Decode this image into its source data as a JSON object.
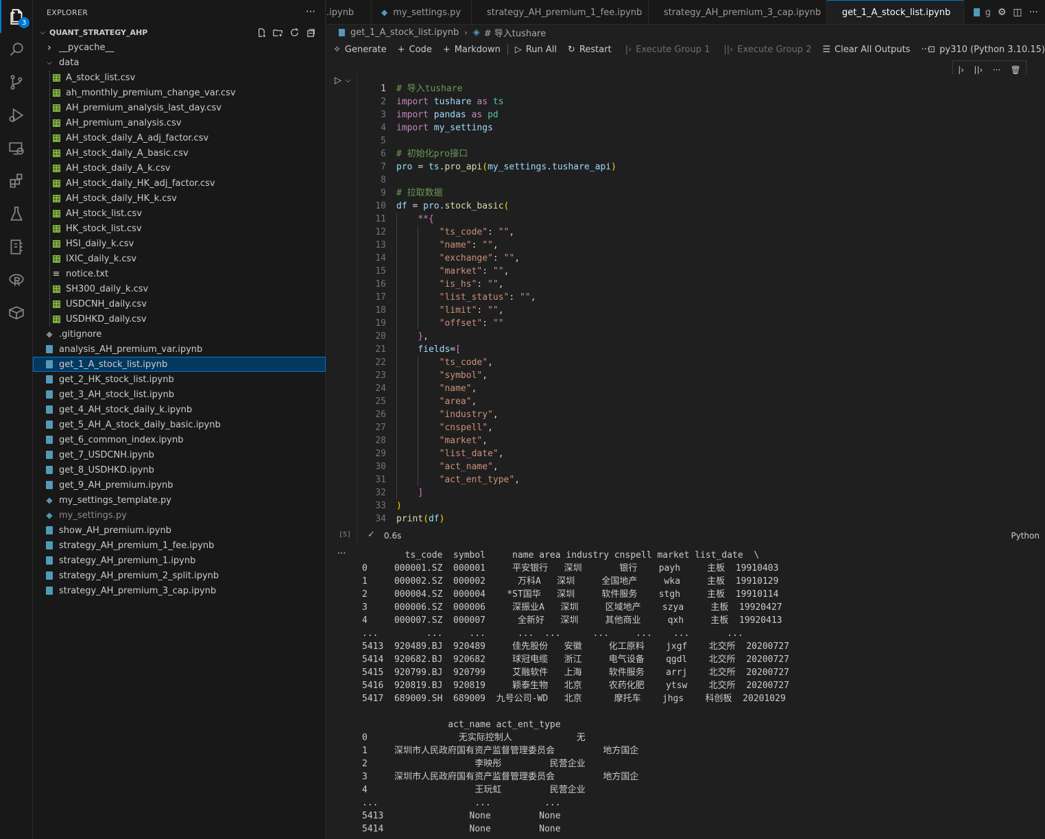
{
  "activity": {
    "explorer_badge": "3"
  },
  "sidebar": {
    "title": "EXPLORER",
    "folder": "QUANT_STRATEGY_AHP",
    "items": [
      {
        "label": "__pycache__",
        "type": "folder-closed",
        "depth": 1
      },
      {
        "label": "data",
        "type": "folder-open",
        "depth": 1
      },
      {
        "label": "A_stock_list.csv",
        "type": "csv",
        "depth": 2
      },
      {
        "label": "ah_monthly_premium_change_var.csv",
        "type": "csv",
        "depth": 2
      },
      {
        "label": "AH_premium_analysis_last_day.csv",
        "type": "csv",
        "depth": 2
      },
      {
        "label": "AH_premium_analysis.csv",
        "type": "csv",
        "depth": 2
      },
      {
        "label": "AH_stock_daily_A_adj_factor.csv",
        "type": "csv",
        "depth": 2
      },
      {
        "label": "AH_stock_daily_A_basic.csv",
        "type": "csv",
        "depth": 2
      },
      {
        "label": "AH_stock_daily_A_k.csv",
        "type": "csv",
        "depth": 2
      },
      {
        "label": "AH_stock_daily_HK_adj_factor.csv",
        "type": "csv",
        "depth": 2
      },
      {
        "label": "AH_stock_daily_HK_k.csv",
        "type": "csv",
        "depth": 2
      },
      {
        "label": "AH_stock_list.csv",
        "type": "csv",
        "depth": 2
      },
      {
        "label": "HK_stock_list.csv",
        "type": "csv",
        "depth": 2
      },
      {
        "label": "HSI_daily_k.csv",
        "type": "csv",
        "depth": 2
      },
      {
        "label": "IXIC_daily_k.csv",
        "type": "csv",
        "depth": 2
      },
      {
        "label": "notice.txt",
        "type": "txt",
        "depth": 2
      },
      {
        "label": "SH300_daily_k.csv",
        "type": "csv",
        "depth": 2
      },
      {
        "label": "USDCNH_daily.csv",
        "type": "csv",
        "depth": 2
      },
      {
        "label": "USDHKD_daily.csv",
        "type": "csv",
        "depth": 2
      },
      {
        "label": ".gitignore",
        "type": "git",
        "depth": 1
      },
      {
        "label": "analysis_AH_premium_var.ipynb",
        "type": "nb",
        "depth": 1
      },
      {
        "label": "get_1_A_stock_list.ipynb",
        "type": "nb",
        "depth": 1,
        "selected": true
      },
      {
        "label": "get_2_HK_stock_list.ipynb",
        "type": "nb",
        "depth": 1
      },
      {
        "label": "get_3_AH_stock_list.ipynb",
        "type": "nb",
        "depth": 1
      },
      {
        "label": "get_4_AH_stock_daily_k.ipynb",
        "type": "nb",
        "depth": 1
      },
      {
        "label": "get_5_AH_A_stock_daily_basic.ipynb",
        "type": "nb",
        "depth": 1
      },
      {
        "label": "get_6_common_index.ipynb",
        "type": "nb",
        "depth": 1
      },
      {
        "label": "get_7_USDCNH.ipynb",
        "type": "nb",
        "depth": 1
      },
      {
        "label": "get_8_USDHKD.ipynb",
        "type": "nb",
        "depth": 1
      },
      {
        "label": "get_9_AH_premium.ipynb",
        "type": "nb",
        "depth": 1
      },
      {
        "label": "my_settings_template.py",
        "type": "py",
        "depth": 1
      },
      {
        "label": "my_settings.py",
        "type": "py",
        "depth": 1,
        "dim": true
      },
      {
        "label": "show_AH_premium.ipynb",
        "type": "nb",
        "depth": 1
      },
      {
        "label": "strategy_AH_premium_1_fee.ipynb",
        "type": "nb",
        "depth": 1
      },
      {
        "label": "strategy_AH_premium_1.ipynb",
        "type": "nb",
        "depth": 1
      },
      {
        "label": "strategy_AH_premium_2_split.ipynb",
        "type": "nb",
        "depth": 1
      },
      {
        "label": "strategy_AH_premium_3_cap.ipynb",
        "type": "nb",
        "depth": 1
      }
    ]
  },
  "tabs": [
    {
      "label": ".ipynb",
      "type": "nb",
      "dirty": false
    },
    {
      "label": "my_settings.py",
      "type": "py",
      "dirty": false
    },
    {
      "label": "strategy_AH_premium_1_fee.ipynb",
      "type": "nb",
      "dirty": false
    },
    {
      "label": "strategy_AH_premium_3_cap.ipynb",
      "type": "nb",
      "dirty": true
    },
    {
      "label": "get_1_A_stock_list.ipynb",
      "type": "nb",
      "dirty": true,
      "active": true
    },
    {
      "label": "ge",
      "type": "nb",
      "dirty": false
    }
  ],
  "breadcrumb": {
    "file": "get_1_A_stock_list.ipynb",
    "cell": "# 导入tushare"
  },
  "toolbar": {
    "generate": "Generate",
    "code": "Code",
    "markdown": "Markdown",
    "run_all": "Run All",
    "restart": "Restart",
    "exec1": "Execute Group 1",
    "exec2": "Execute Group 2",
    "clear": "Clear All Outputs",
    "more": "···",
    "kernel": "py310 (Python 3.10.15)"
  },
  "cell": {
    "exec_count": "[5]",
    "time": "0.6s",
    "language": "Python",
    "code_lines": [
      "# 导入tushare",
      "import tushare as ts",
      "import pandas as pd",
      "import my_settings",
      "",
      "# 初始化pro接口",
      "pro = ts.pro_api(my_settings.tushare_api)",
      "",
      "# 拉取数据",
      "df = pro.stock_basic(",
      "    **{",
      "        \"ts_code\": \"\",",
      "        \"name\": \"\",",
      "        \"exchange\": \"\",",
      "        \"market\": \"\",",
      "        \"is_hs\": \"\",",
      "        \"list_status\": \"\",",
      "        \"limit\": \"\",",
      "        \"offset\": \"\"",
      "    },",
      "    fields=[",
      "        \"ts_code\",",
      "        \"symbol\",",
      "        \"name\",",
      "        \"area\",",
      "        \"industry\",",
      "        \"cnspell\",",
      "        \"market\",",
      "        \"list_date\",",
      "        \"act_name\",",
      "        \"act_ent_type\",",
      "    ]",
      ")",
      "print(df)"
    ]
  },
  "output": [
    "        ts_code  symbol     name area industry cnspell market list_date  \\",
    "0     000001.SZ  000001     平安银行   深圳       银行    payh     主板  19910403",
    "1     000002.SZ  000002      万科A   深圳     全国地产     wka     主板  19910129",
    "2     000004.SZ  000004    *ST国华   深圳     软件服务    stgh     主板  19910114",
    "3     000006.SZ  000006     深振业A   深圳     区域地产    szya     主板  19920427",
    "4     000007.SZ  000007      全新好   深圳     其他商业     qxh     主板  19920413",
    "...         ...     ...      ...  ...      ...     ...    ...       ...",
    "5413  920489.BJ  920489     佳先股份   安徽     化工原料    jxgf    北交所  20200727",
    "5414  920682.BJ  920682     球冠电缆   浙江     电气设备    qgdl    北交所  20200727",
    "5415  920799.BJ  920799     艾融软件   上海     软件服务    arrj    北交所  20200727",
    "5416  920819.BJ  920819     颖泰生物   北京     农药化肥    ytsw    北交所  20200727",
    "5417  689009.SH  689009  九号公司-WD   北京      摩托车    jhgs    科创板  20201029",
    "",
    "                act_name act_ent_type",
    "0                 无实际控制人            无",
    "1     深圳市人民政府国有资产监督管理委员会         地方国企",
    "2                    李映彤         民营企业",
    "3     深圳市人民政府国有资产监督管理委员会         地方国企",
    "4                    王玩虹         民营企业",
    "...                  ...          ...",
    "5413                None         None",
    "5414                None         None"
  ]
}
